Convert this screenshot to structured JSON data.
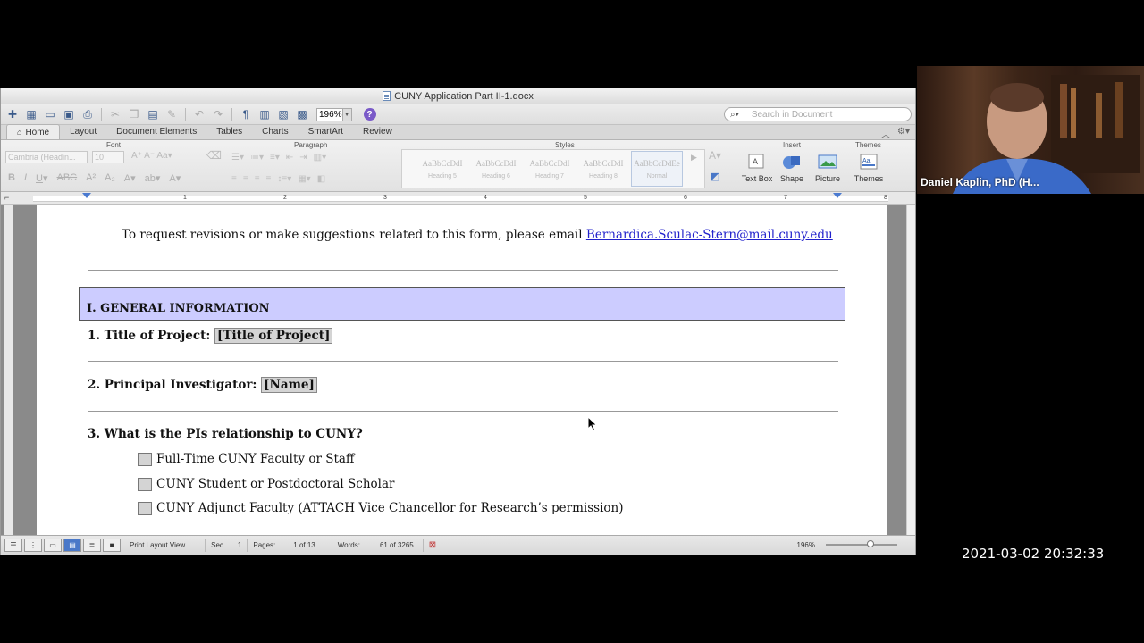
{
  "window": {
    "title": "CUNY Application Part II-1.docx",
    "zoom": "196%",
    "search_placeholder": "Search in Document"
  },
  "ribbon_tabs": [
    "Home",
    "Layout",
    "Document Elements",
    "Tables",
    "Charts",
    "SmartArt",
    "Review"
  ],
  "ribbon": {
    "group_font": "Font",
    "group_paragraph": "Paragraph",
    "group_styles": "Styles",
    "group_insert": "Insert",
    "group_themes": "Themes",
    "font_name": "Cambria (Headin...",
    "font_size": "10",
    "styles": [
      {
        "sample": "AaBbCcDdI",
        "name": "Heading 5"
      },
      {
        "sample": "AaBbCcDdI",
        "name": "Heading 6"
      },
      {
        "sample": "AaBbCcDdI",
        "name": "Heading 7"
      },
      {
        "sample": "AaBbCcDdI",
        "name": "Heading 8"
      },
      {
        "sample": "AaBbCcDdEe",
        "name": "Normal"
      }
    ],
    "insert_items": [
      "Text Box",
      "Shape",
      "Picture"
    ],
    "themes_label": "Themes"
  },
  "ruler_numbers": [
    "1",
    "2",
    "3",
    "4",
    "5",
    "6",
    "7",
    "8"
  ],
  "document": {
    "email_prefix": "To request revisions or make suggestions related to this form, please email ",
    "email_link": "Bernardica.Sculac-Stern@mail.cuny.edu",
    "section_title": "I. GENERAL INFORMATION",
    "q1_label": "1.  Title of Project: ",
    "q1_field": "[Title of Project]",
    "q2_label": "2.  Principal Investigator: ",
    "q2_field": "[Name]",
    "q3_label": "3. What is the PIs relationship to CUNY?",
    "options": [
      "Full-Time CUNY Faculty or Staff",
      "CUNY Student or Postdoctoral Scholar",
      "CUNY Adjunct Faculty (ATTACH Vice Chancellor for Research’s permission)"
    ]
  },
  "status": {
    "view": "Print Layout View",
    "sec_label": "Sec",
    "sec_value": "1",
    "pages_label": "Pages:",
    "pages_value": "1 of 13",
    "words_label": "Words:",
    "words_value": "61 of 3265",
    "zoom": "196%"
  },
  "webcam": {
    "participant_name": "Daniel Kaplin, PhD (H..."
  },
  "timestamp": "2021-03-02  20:32:33"
}
